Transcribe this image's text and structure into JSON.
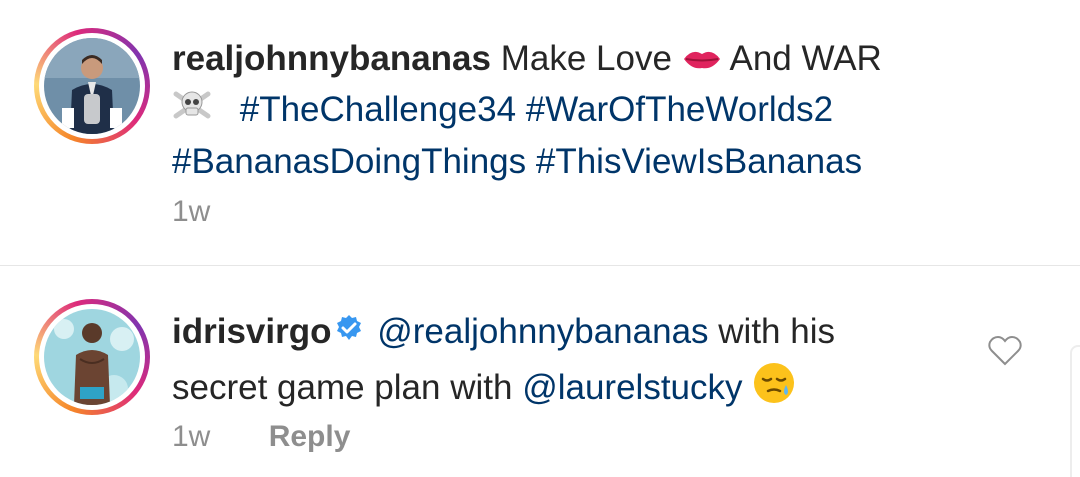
{
  "caption": {
    "username": "realjohnnybananas",
    "text_part1": "Make Love",
    "text_part2": "And WAR",
    "hashtags": [
      "#TheChallenge34",
      "#WarOfTheWorlds2",
      "#BananasDoingThings",
      "#ThisViewIsBananas"
    ],
    "time": "1w",
    "emoji_1": "kiss-lips",
    "emoji_2": "skull-crossbones"
  },
  "comment": {
    "username": "idrisvirgo",
    "verified": true,
    "mention_1": "@realjohnnybananas",
    "text_part1": "with his",
    "text_part2": "secret game plan with",
    "mention_2": "@laurelstucky",
    "emoji": "sleepy-face",
    "time": "1w",
    "reply_label": "Reply"
  },
  "colors": {
    "link": "#003569",
    "username": "#262626",
    "meta": "#8e8e8e",
    "verified": "#3897f0"
  }
}
